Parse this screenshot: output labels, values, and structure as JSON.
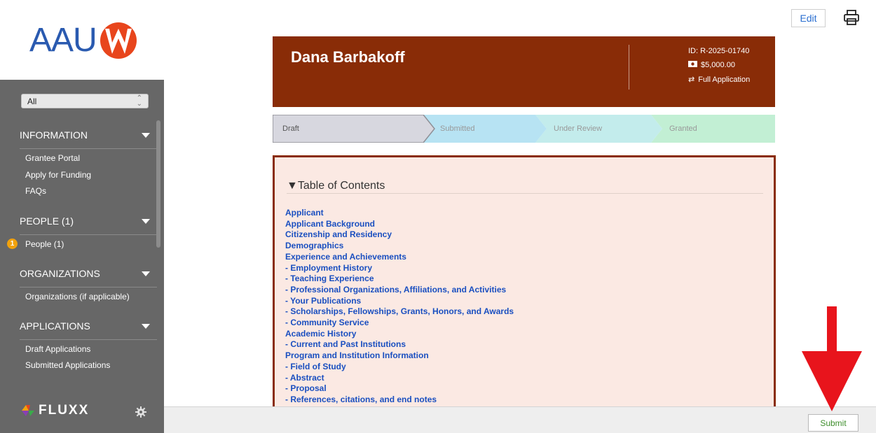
{
  "sidebar": {
    "logo_text": "AAU",
    "filter": {
      "selected": "All"
    },
    "sections": [
      {
        "title": "INFORMATION",
        "items": [
          "Grantee Portal",
          "Apply for Funding",
          "FAQs"
        ]
      },
      {
        "title": "PEOPLE (1)",
        "items": [
          "People  (1)"
        ],
        "badge": "1"
      },
      {
        "title": "ORGANIZATIONS",
        "items": [
          "Organizations (if applicable)"
        ]
      },
      {
        "title": "APPLICATIONS",
        "items": [
          "Draft Applications",
          "Submitted Applications"
        ]
      }
    ],
    "footer_brand": "FLUXX"
  },
  "toolbar": {
    "edit_label": "Edit"
  },
  "header": {
    "name": "Dana Barbakoff",
    "id_label": "ID:",
    "id_value": "R-2025-01740",
    "amount": "$5,000.00",
    "type": "Full Application"
  },
  "status": {
    "steps": [
      "Draft",
      "Submitted",
      "Under Review",
      "Granted"
    ],
    "colors": [
      "#d7d7df",
      "#b7e3f3",
      "#c3ecec",
      "#c2efd4"
    ]
  },
  "toc": {
    "title": "▼Table of Contents",
    "items": [
      "Applicant",
      "Applicant Background",
      "Citizenship and Residency",
      "Demographics",
      "Experience and Achievements",
      "- Employment History",
      "- Teaching Experience",
      "- Professional Organizations, Affiliations, and Activities",
      "- Your Publications",
      "- Scholarships, Fellowships, Grants, Honors, and Awards",
      "- Community Service",
      "Academic History",
      "- Current and Past Institutions",
      "Program and Institution Information",
      "- Field of Study",
      "- Abstract",
      "- Proposal",
      "- References, citations, and end notes"
    ]
  },
  "footer": {
    "submit_label": "Submit"
  },
  "colors": {
    "brand_brown": "#892c07",
    "link_blue": "#1a4fc0",
    "arrow_red": "#e8141c",
    "sidebar_gray": "#676767"
  }
}
